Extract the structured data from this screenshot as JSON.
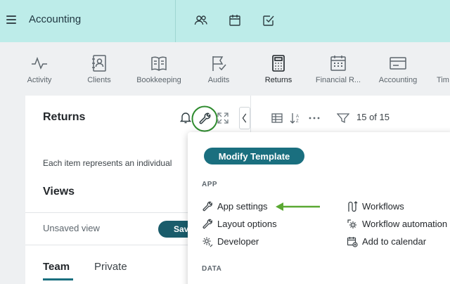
{
  "header": {
    "app_title": "Accounting",
    "icons": [
      "people-icon",
      "calendar-icon",
      "checkbox-icon"
    ]
  },
  "nav": {
    "items": [
      {
        "label": "Activity",
        "icon": "activity-icon"
      },
      {
        "label": "Clients",
        "icon": "contacts-book-icon"
      },
      {
        "label": "Bookkeeping",
        "icon": "book-icon"
      },
      {
        "label": "Audits",
        "icon": "flag-icon"
      },
      {
        "label": "Returns",
        "icon": "calculator-icon",
        "active": true
      },
      {
        "label": "Financial R...",
        "icon": "calendar-grid-icon"
      },
      {
        "label": "Accounting",
        "icon": "card-icon"
      },
      {
        "label": "Tim",
        "icon": "clock-icon"
      }
    ]
  },
  "panel": {
    "title": "Returns",
    "description": "Each item represents an individual",
    "views_heading": "Views",
    "unsaved_view": "Unsaved view",
    "save_label": "Save",
    "tabs": {
      "team": "Team",
      "private": "Private"
    }
  },
  "toolbar": {
    "count_text": "15 of 15"
  },
  "menu": {
    "modify_template": "Modify Template",
    "sections": {
      "app": "APP",
      "data": "DATA"
    },
    "app_items": [
      {
        "label": "App settings",
        "icon": "wrench-icon"
      },
      {
        "label": "Layout options",
        "icon": "wrench-icon"
      },
      {
        "label": "Developer",
        "icon": "developer-gear-icon"
      }
    ],
    "app_items_right": [
      {
        "label": "Workflows",
        "icon": "workflow-icon"
      },
      {
        "label": "Workflow automation",
        "icon": "workflow-gear-icon"
      },
      {
        "label": "Add to calendar",
        "icon": "calendar-add-icon"
      }
    ]
  },
  "colors": {
    "header_bg": "#bdece9",
    "accent": "#1a6f7f",
    "highlight_circle": "#2e8b2e",
    "arrow": "#5aa832"
  }
}
